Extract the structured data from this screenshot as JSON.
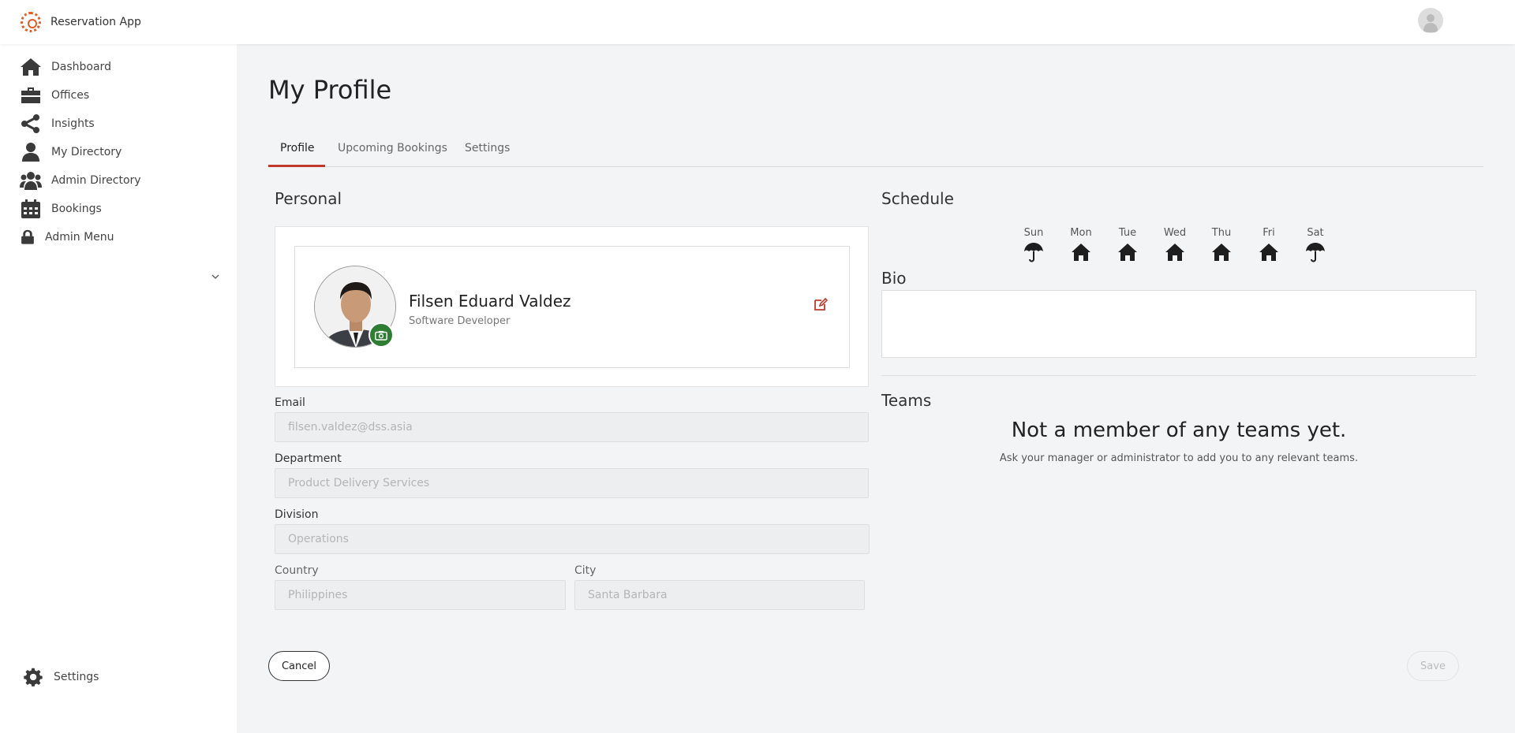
{
  "app": {
    "name": "Reservation App"
  },
  "sidebar": {
    "items": [
      {
        "label": "Dashboard",
        "icon": "home-icon"
      },
      {
        "label": "Offices",
        "icon": "briefcase-icon"
      },
      {
        "label": "Insights",
        "icon": "share-icon"
      },
      {
        "label": "My Directory",
        "icon": "user-icon"
      },
      {
        "label": "Admin Directory",
        "icon": "users-icon"
      },
      {
        "label": "Bookings",
        "icon": "calendar-icon"
      },
      {
        "label": "Admin Menu",
        "icon": "lock-icon"
      }
    ],
    "settings_label": "Settings"
  },
  "page": {
    "title": "My Profile",
    "tabs": [
      "Profile",
      "Upcoming Bookings",
      "Settings"
    ],
    "active_tab": "Profile"
  },
  "personal": {
    "section_title": "Personal",
    "name": "Filsen Eduard Valdez",
    "role": "Software Developer",
    "email_label": "Email",
    "email": "filsen.valdez@dss.asia",
    "department_label": "Department",
    "department": "Product Delivery Services",
    "division_label": "Division",
    "division": "Operations",
    "country_label": "Country",
    "country": "Philippines",
    "city_label": "City",
    "city": "Santa Barbara"
  },
  "schedule": {
    "section_title": "Schedule",
    "days": [
      {
        "label": "Sun",
        "mode": "umbrella-icon"
      },
      {
        "label": "Mon",
        "mode": "home-icon"
      },
      {
        "label": "Tue",
        "mode": "home-icon"
      },
      {
        "label": "Wed",
        "mode": "home-icon"
      },
      {
        "label": "Thu",
        "mode": "home-icon"
      },
      {
        "label": "Fri",
        "mode": "home-icon"
      },
      {
        "label": "Sat",
        "mode": "umbrella-icon"
      }
    ]
  },
  "bio": {
    "section_title": "Bio",
    "value": ""
  },
  "teams": {
    "section_title": "Teams",
    "empty_title": "Not a member of any teams yet.",
    "empty_subtitle": "Ask your manager or administrator to add you to any relevant teams."
  },
  "actions": {
    "cancel_label": "Cancel",
    "save_label": "Save"
  },
  "colors": {
    "accent": "#c0392b",
    "brand": "#e35b1e",
    "camera": "#2e7d32"
  }
}
